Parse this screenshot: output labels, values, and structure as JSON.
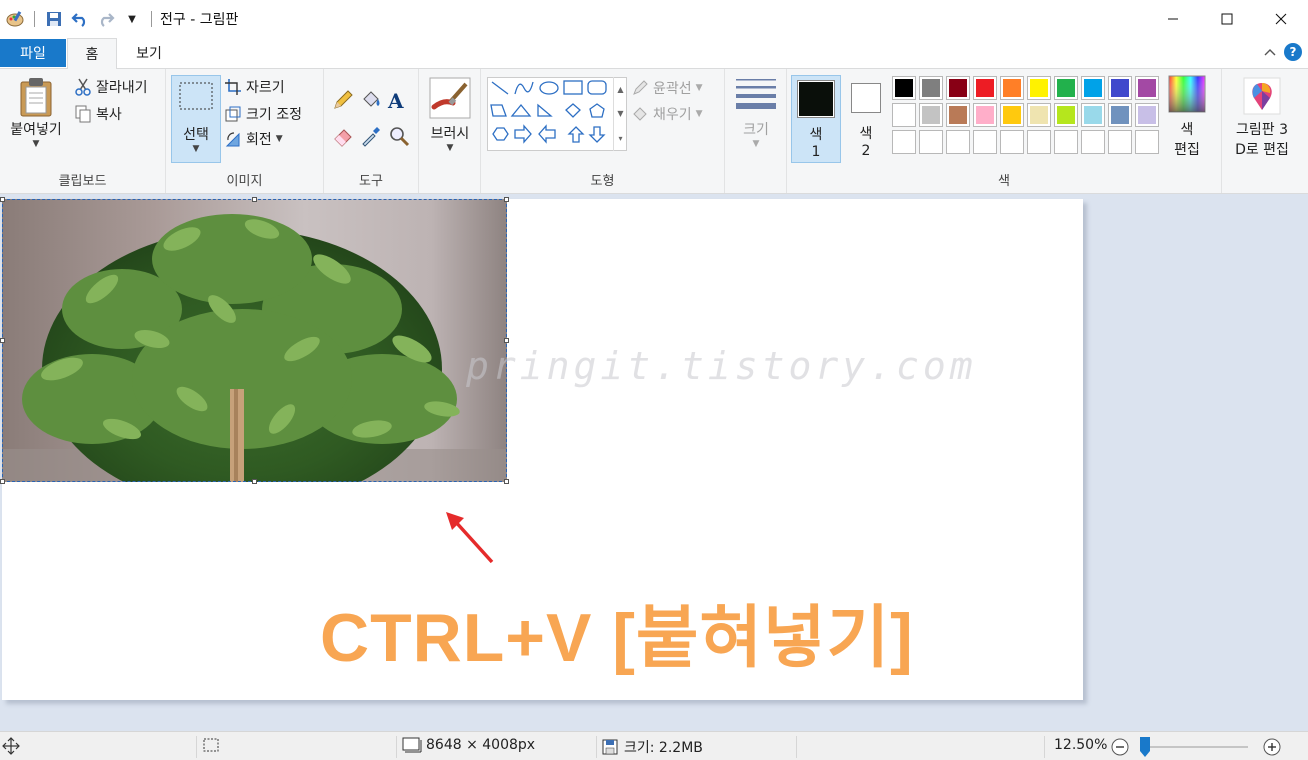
{
  "window": {
    "title": "전구 - 그림판"
  },
  "tabs": {
    "file": "파일",
    "home": "홈",
    "view": "보기"
  },
  "ribbon": {
    "clipboard": {
      "paste": "붙여넣기",
      "cut": "잘라내기",
      "copy": "복사",
      "group": "클립보드"
    },
    "image": {
      "select": "선택",
      "crop": "자르기",
      "resize": "크기 조정",
      "rotate": "회전",
      "group": "이미지"
    },
    "tools": {
      "group": "도구"
    },
    "brushes": {
      "label": "브러시"
    },
    "shapes": {
      "outline": "윤곽선",
      "fill": "채우기",
      "group": "도형"
    },
    "size": {
      "label": "크기"
    },
    "colors": {
      "color1": "색",
      "color1_num": "1",
      "color2": "색",
      "color2_num": "2",
      "edit": "색",
      "edit2": "편집",
      "group": "색",
      "palette_row1": [
        "#000000",
        "#7f7f7f",
        "#880015",
        "#ed1c24",
        "#ff7f27",
        "#fff200",
        "#22b14c",
        "#00a2e8",
        "#3f48cc",
        "#a349a4"
      ],
      "palette_row2": [
        "#ffffff",
        "#c3c3c3",
        "#b97a57",
        "#ffaec9",
        "#ffc90e",
        "#efe4b0",
        "#b5e61d",
        "#99d9ea",
        "#7092be",
        "#c8bfe7"
      ]
    },
    "paint3d": {
      "line1": "그림판 3",
      "line2": "D로 편집"
    }
  },
  "canvas": {
    "watermark": "pringit.tistory.com",
    "caption": "CTRL+V [붙혀넣기]"
  },
  "statusbar": {
    "dimensions": "8648 × 4008px",
    "size": "크기: 2.2MB",
    "zoom": "12.50%",
    "zoom_level": 0.05
  }
}
